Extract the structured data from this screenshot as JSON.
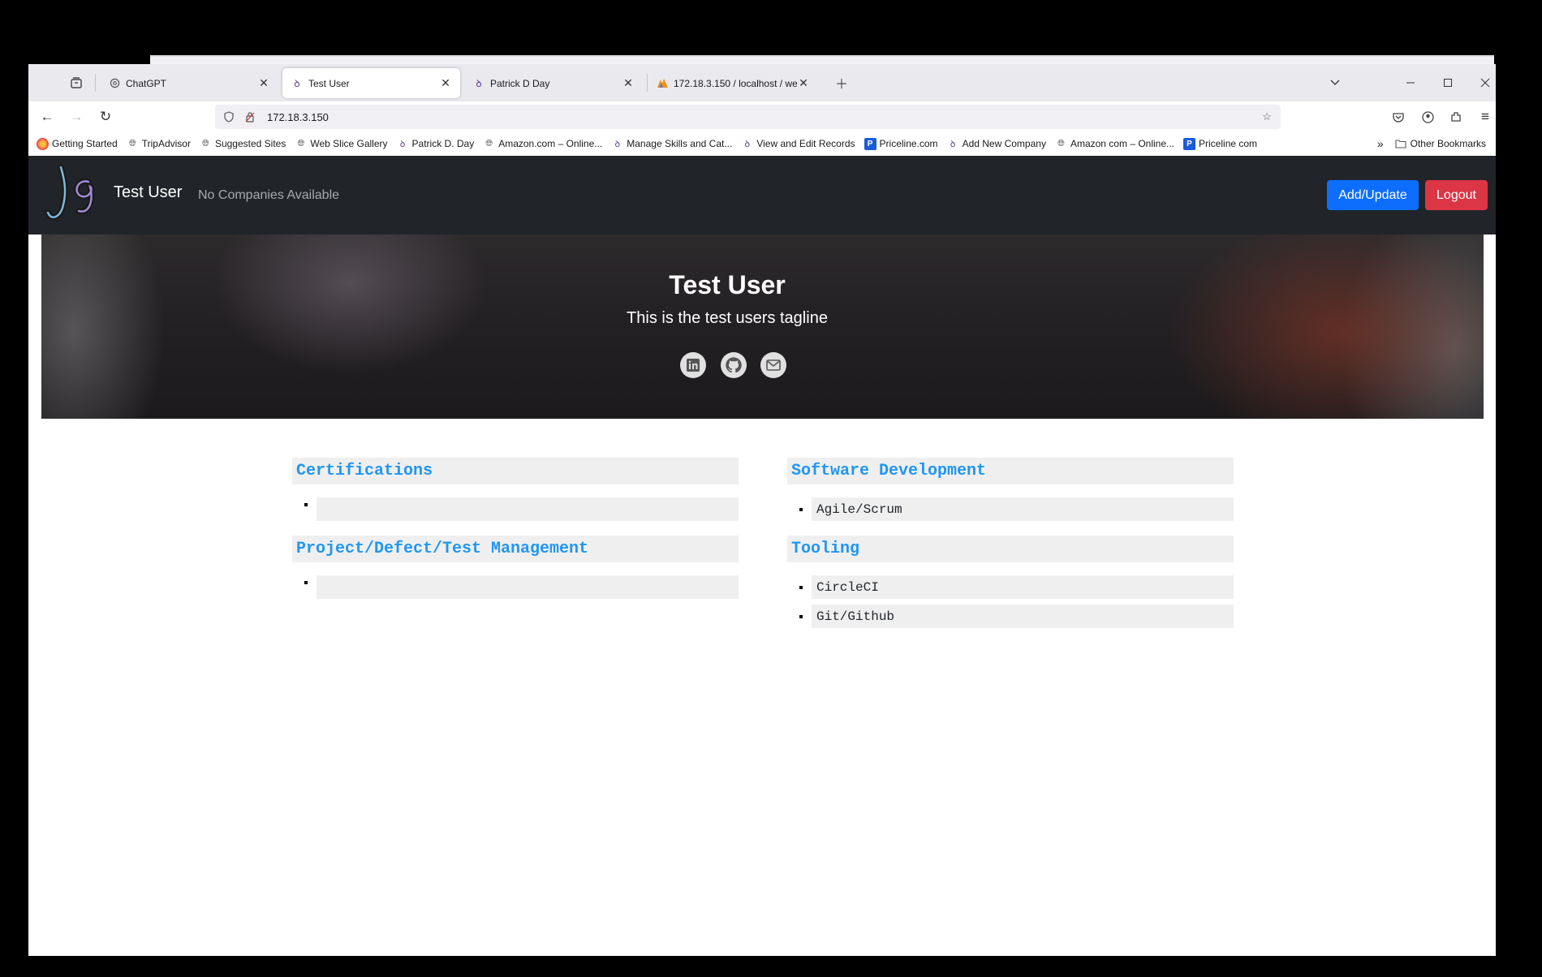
{
  "browser": {
    "tabs": [
      {
        "title": "ChatGPT",
        "icon": "chatgpt-icon"
      },
      {
        "title": "Test User",
        "icon": "site-icon",
        "active": true
      },
      {
        "title": "Patrick D Day",
        "icon": "site-icon"
      },
      {
        "title": "172.18.3.150 / localhost / webre",
        "icon": "phpmyadmin-icon"
      }
    ],
    "url": "172.18.3.150",
    "bookmarks": [
      {
        "label": "Getting Started",
        "icon": "firefox-icon"
      },
      {
        "label": "TripAdvisor",
        "icon": "globe-icon"
      },
      {
        "label": "Suggested Sites",
        "icon": "globe-icon"
      },
      {
        "label": "Web Slice Gallery",
        "icon": "globe-icon"
      },
      {
        "label": "Patrick D. Day",
        "icon": "site-icon"
      },
      {
        "label": "Amazon.com – Online...",
        "icon": "globe-icon"
      },
      {
        "label": "Manage Skills and Cat...",
        "icon": "site-icon"
      },
      {
        "label": "View and Edit Records",
        "icon": "site-icon"
      },
      {
        "label": "Priceline.com",
        "icon": "priceline-icon"
      },
      {
        "label": "Add New Company",
        "icon": "site-icon"
      },
      {
        "label": "Amazon com – Online...",
        "icon": "globe-icon"
      },
      {
        "label": "Priceline com",
        "icon": "priceline-icon"
      }
    ],
    "other_bookmarks": "Other Bookmarks"
  },
  "site": {
    "brand": "Test User",
    "companies": "No Companies Available",
    "add_update": "Add/Update",
    "logout": "Logout",
    "accent": "#0d6efd",
    "danger": "#dc3545"
  },
  "hero": {
    "title": "Test User",
    "tagline": "This is the test users tagline",
    "social": [
      "linkedin-icon",
      "github-icon",
      "email-icon"
    ]
  },
  "sections": {
    "certifications": {
      "heading": "Certifications",
      "items": [
        ""
      ]
    },
    "software": {
      "heading": "Software Development",
      "items": [
        "Agile/Scrum"
      ]
    },
    "project": {
      "heading": "Project/Defect/Test Management",
      "items": [
        ""
      ]
    },
    "tooling": {
      "heading": "Tooling",
      "items": [
        "CircleCI",
        "Git/Github"
      ]
    }
  }
}
